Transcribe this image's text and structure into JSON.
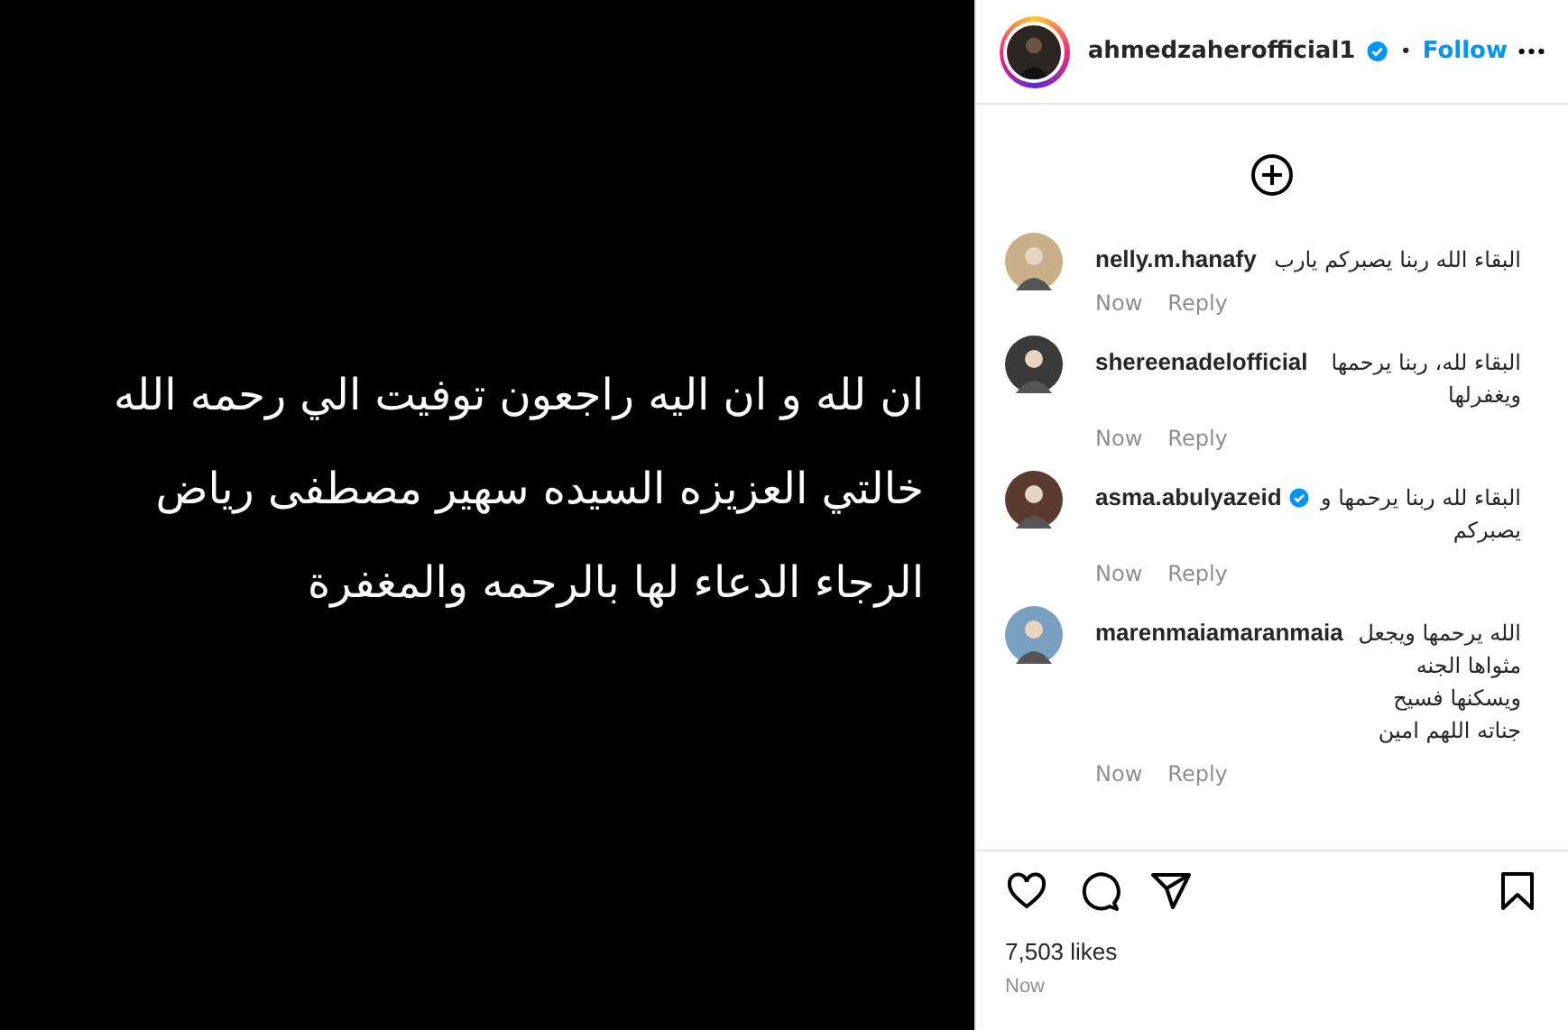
{
  "post": {
    "lines": [
      "ان لله و ان اليه راجعون توفيت الي رحمه الله",
      "خالتي العزيزه السيده سهير مصطفى رياض",
      "الرجاء الدعاء لها بالرحمه والمغفرة"
    ]
  },
  "header": {
    "username": "ahmedzaherofficial1",
    "verified": true,
    "separator": "•",
    "follow": "Follow"
  },
  "comments": [
    {
      "user": "nelly.m.hanafy",
      "verified": false,
      "text": "البقاء الله ربنا يصبركم يارب",
      "time": "Now",
      "reply": "Reply"
    },
    {
      "user": "shereenadelofficial",
      "verified": false,
      "text": "البقاء لله، ربنا يرحمها ويغفرلها",
      "time": "Now",
      "reply": "Reply"
    },
    {
      "user": "asma.abulyazeid",
      "verified": true,
      "text": "البقاء لله ربنا يرحمها و يصبركم",
      "time": "Now",
      "reply": "Reply"
    },
    {
      "user": "marenmaiamaranmaia",
      "verified": false,
      "text": "الله يرحمها ويجعل مثواها الجنه ويسكنها فسيح جناته اللهم امين",
      "time": "Now",
      "reply": "Reply"
    }
  ],
  "likes": "7,503 likes",
  "time": "Now"
}
